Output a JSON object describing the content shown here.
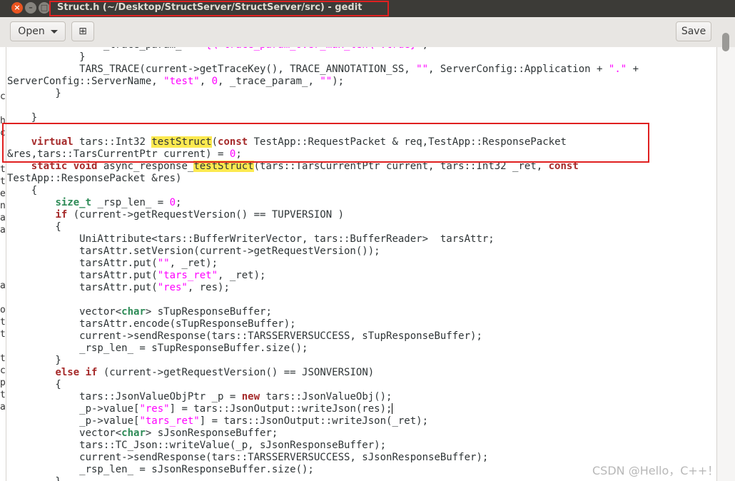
{
  "window": {
    "title": "Struct.h (~/Desktop/StructServer/StructServer/src) - gedit",
    "close_glyph": "×",
    "min_glyph": "–",
    "max_glyph": "□"
  },
  "toolbar": {
    "open_label": "Open",
    "new_tab_glyph": "⊞",
    "save_label": "Save"
  },
  "editor": {
    "left_fragments": [
      "c",
      "h",
      "c",
      "t",
      "t",
      "e",
      "n",
      "a",
      "a",
      "a",
      "o",
      "t",
      "t",
      "t",
      "c",
      "p",
      "t",
      "a"
    ]
  },
  "watermark": "CSDN @Hello，C++！"
}
